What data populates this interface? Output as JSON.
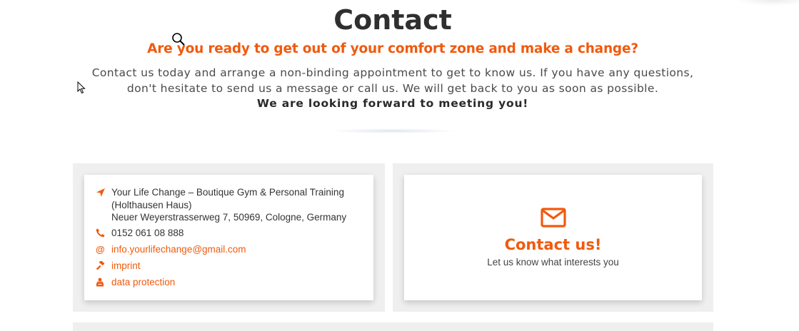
{
  "header": {
    "title": "Contact",
    "subtitle": "Are you ready to get out of your comfort zone and make a change?",
    "description": "Contact us today and arrange a non-binding appointment to get to know us. If you have any questions, don't hesitate to send us a message or call us. We will get back to you as soon as possible.",
    "closing": "We are looking forward to meeting you!"
  },
  "info": {
    "address_line1": "Your Life Change – Boutique Gym & Personal Training",
    "address_line2": "(Holthausen Haus)",
    "address_line3": "Neuer Weyerstrasserweg 7, 50969, Cologne, Germany",
    "phone": "0152 061 08 888",
    "email": "info.yourlifechange@gmail.com",
    "imprint": "imprint",
    "privacy": "data protection"
  },
  "contact_card": {
    "title": "Contact us!",
    "subtitle": "Let us know what interests you",
    "icon": "envelope-icon"
  },
  "colors": {
    "accent": "#f05a0e",
    "heading": "#2f2f2f",
    "panel": "#efefef"
  }
}
